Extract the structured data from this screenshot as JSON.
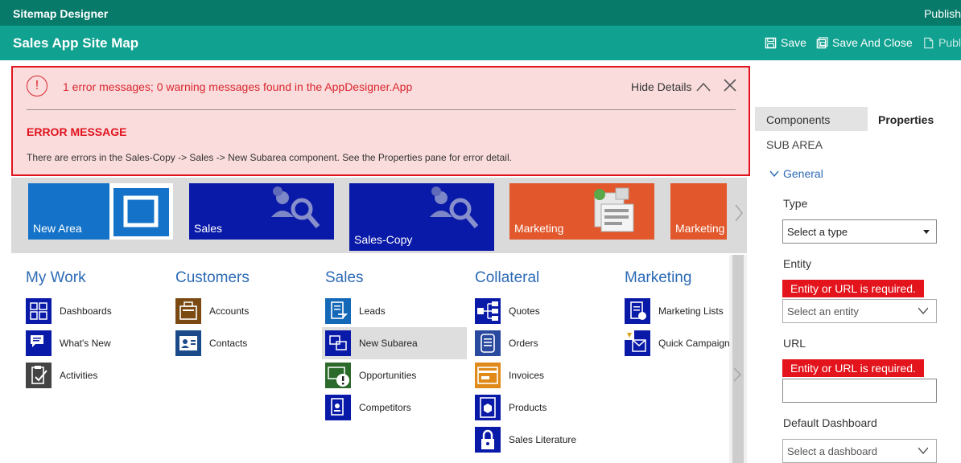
{
  "window": {
    "title": "Sitemap Designer",
    "top_right": "Publish"
  },
  "commandbar": {
    "title": "Sales App Site Map",
    "save": "Save",
    "save_close": "Save And Close",
    "publish": "Publi"
  },
  "error_banner": {
    "icon_glyph": "!",
    "message": "1 error messages; 0 warning messages found in the AppDesigner.App",
    "hide_details": "Hide Details",
    "heading": "ERROR MESSAGE",
    "detail": "There are errors in the Sales-Copy -> Sales -> New Subarea component. See the Properties pane for error detail."
  },
  "tiles": [
    {
      "label": "New Area",
      "color": "#1473c8",
      "art": "frame-icon"
    },
    {
      "label": "Sales",
      "color": "#0a1aa8",
      "art": "users-search-icon"
    },
    {
      "label": "Sales-Copy",
      "color": "#0a1aa8",
      "art": "users-search-icon"
    },
    {
      "label": "Marketing",
      "color": "#e2572b",
      "art": "marketing-icon"
    },
    {
      "label": "Marketing",
      "color": "#e2572b",
      "art": ""
    }
  ],
  "groups": [
    {
      "title": "My Work",
      "items": [
        {
          "label": "Dashboards",
          "icon": "dashboard-icon"
        },
        {
          "label": "What's New",
          "icon": "whats-new-icon"
        },
        {
          "label": "Activities",
          "icon": "activities-icon"
        }
      ]
    },
    {
      "title": "Customers",
      "items": [
        {
          "label": "Accounts",
          "icon": "accounts-icon"
        },
        {
          "label": "Contacts",
          "icon": "contacts-icon"
        }
      ]
    },
    {
      "title": "Sales",
      "items": [
        {
          "label": "Leads",
          "icon": "leads-icon"
        },
        {
          "label": "New Subarea",
          "icon": "subarea-icon"
        },
        {
          "label": "Opportunities",
          "icon": "opportunities-icon"
        },
        {
          "label": "Competitors",
          "icon": "competitors-icon"
        }
      ]
    },
    {
      "title": "Collateral",
      "items": [
        {
          "label": "Quotes",
          "icon": "quotes-icon"
        },
        {
          "label": "Orders",
          "icon": "orders-icon"
        },
        {
          "label": "Invoices",
          "icon": "invoices-icon"
        },
        {
          "label": "Products",
          "icon": "products-icon"
        },
        {
          "label": "Sales Literature",
          "icon": "lock-icon"
        }
      ]
    },
    {
      "title": "Marketing",
      "items": [
        {
          "label": "Marketing Lists",
          "icon": "marketing-lists-icon"
        },
        {
          "label": "Quick Campaign",
          "icon": "quick-campaign-icon"
        }
      ]
    }
  ],
  "properties": {
    "tab_components": "Components",
    "tab_properties": "Properties",
    "section": "SUB AREA",
    "general": "General",
    "type_label": "Type",
    "type_value": "Select a type",
    "entity_label": "Entity",
    "entity_error": "Entity or URL is required.",
    "entity_placeholder": "Select an entity",
    "url_label": "URL",
    "url_error": "Entity or URL is required.",
    "url_value": "",
    "dashboard_label": "Default Dashboard",
    "dashboard_placeholder": "Select a dashboard"
  },
  "colors": {
    "header_dark": "#087a6a",
    "header": "#10a190",
    "error_red": "#e0141e",
    "error_bg": "#fadcdc",
    "link_blue": "#2c6ab5",
    "icon_navy": "#0a1aa8"
  }
}
